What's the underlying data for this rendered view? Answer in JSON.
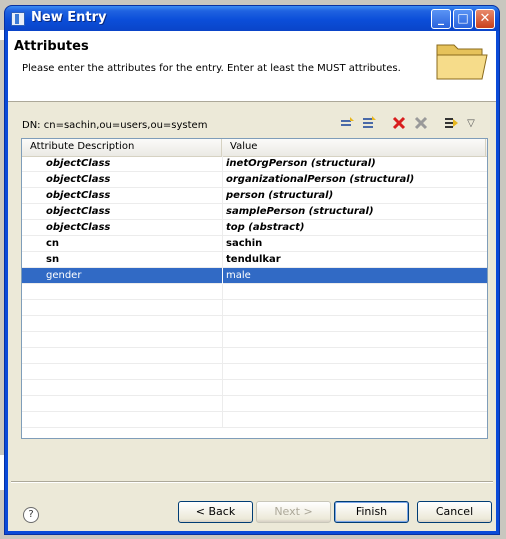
{
  "window": {
    "title": "New Entry"
  },
  "header": {
    "title": "Attributes",
    "description": "Please enter the attributes for the entry. Enter at least the MUST attributes."
  },
  "dn": "DN: cn=sachin,ou=users,ou=system",
  "table": {
    "columns": [
      "Attribute Description",
      "Value"
    ],
    "rows": [
      {
        "attribute": "objectClass",
        "value": "inetOrgPerson (structural)"
      },
      {
        "attribute": "objectClass",
        "value": "organizationalPerson (structural)"
      },
      {
        "attribute": "objectClass",
        "value": "person (structural)"
      },
      {
        "attribute": "objectClass",
        "value": "samplePerson (structural)"
      },
      {
        "attribute": "objectClass",
        "value": "top (abstract)"
      },
      {
        "attribute": "cn",
        "value": "sachin"
      },
      {
        "attribute": "sn",
        "value": "tendulkar"
      },
      {
        "attribute": "gender",
        "value": "male"
      }
    ],
    "selected_row": 8
  },
  "buttons": {
    "back": "< Back",
    "next": "Next >",
    "finish": "Finish",
    "cancel": "Cancel"
  },
  "colors": {
    "selection": "#316ac5",
    "titlebar": "#0b4ed9"
  },
  "icons": [
    "new-attribute-icon",
    "new-value-icon",
    "delete-icon",
    "delete-all-icon",
    "edit-value-icon",
    "view-menu-icon",
    "help-icon",
    "folder-icon"
  ]
}
